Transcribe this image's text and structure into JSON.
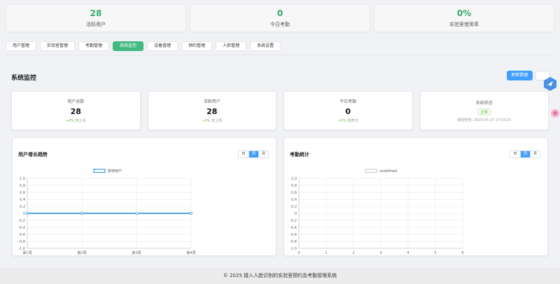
{
  "top_stats": [
    {
      "value": "28",
      "label": "活跃用户"
    },
    {
      "value": "0",
      "label": "今日考勤"
    },
    {
      "value": "0%",
      "label": "实验室使用率"
    }
  ],
  "nav": {
    "tabs": [
      {
        "label": "用户管理",
        "active": false
      },
      {
        "label": "实验室管理",
        "active": false
      },
      {
        "label": "考勤管理",
        "active": false
      },
      {
        "label": "系统监控",
        "active": true
      },
      {
        "label": "设备管理",
        "active": false
      },
      {
        "label": "预约管理",
        "active": false
      },
      {
        "label": "人脸管理",
        "active": false
      },
      {
        "label": "系统设置",
        "active": false
      }
    ]
  },
  "section": {
    "title": "系统监控",
    "refresh_label": "刷新数据"
  },
  "stats": [
    {
      "title": "用户总数",
      "value": "28",
      "change": "+0%",
      "change_suffix": "较上月"
    },
    {
      "title": "活跃用户",
      "value": "28",
      "change": "+0%",
      "change_suffix": "较上周"
    },
    {
      "title": "今日考勤",
      "value": "0",
      "change": "+0%",
      "change_suffix": "较昨日"
    },
    {
      "title": "系统状态",
      "status": "正常",
      "last_check": "最后检查: 2025-05-27 17:03:25"
    }
  ],
  "charts": {
    "growth": {
      "title": "用户增长趋势",
      "periods": [
        "日",
        "周",
        "月"
      ],
      "active_period": "周"
    },
    "attendance": {
      "title": "考勤统计",
      "periods": [
        "日",
        "周",
        "月"
      ],
      "active_period": "周"
    }
  },
  "chart_data": [
    {
      "type": "line",
      "title": "用户增长趋势",
      "categories": [
        "第1周",
        "第2周",
        "第3周",
        "第4周"
      ],
      "series": [
        {
          "name": "新增用户",
          "values": [
            0,
            0,
            0,
            0
          ],
          "color": "#3a9ad9"
        }
      ],
      "ylim": [
        -1.0,
        1.0
      ],
      "yticks": [
        "1.0",
        "0.8",
        "0.6",
        "0.4",
        "0.2",
        "0",
        "-0.2",
        "-0.4",
        "-0.6",
        "-0.8",
        "-1.0"
      ],
      "grid": true,
      "legend": "top-center"
    },
    {
      "type": "line",
      "title": "考勤统计",
      "x": [
        "0",
        "1",
        "2",
        "3",
        "4",
        "5",
        "6"
      ],
      "series": [
        {
          "name": "undefined",
          "values": [],
          "color": "#cccccc"
        }
      ],
      "ylim": [
        -1.0,
        1.0
      ],
      "yticks": [
        "1.0",
        "0.8",
        "0.6",
        "0.4",
        "0.2",
        "0",
        "-0.2",
        "-0.4",
        "-0.6",
        "-0.8",
        "-1.0"
      ],
      "grid": true,
      "legend": "top-center"
    }
  ],
  "footer": {
    "text": "© 2025 接入人脸识别的实验室预约及考勤管理系统"
  },
  "colors": {
    "accent_green": "#42b983",
    "primary_blue": "#409eff",
    "success": "#67c23a"
  }
}
